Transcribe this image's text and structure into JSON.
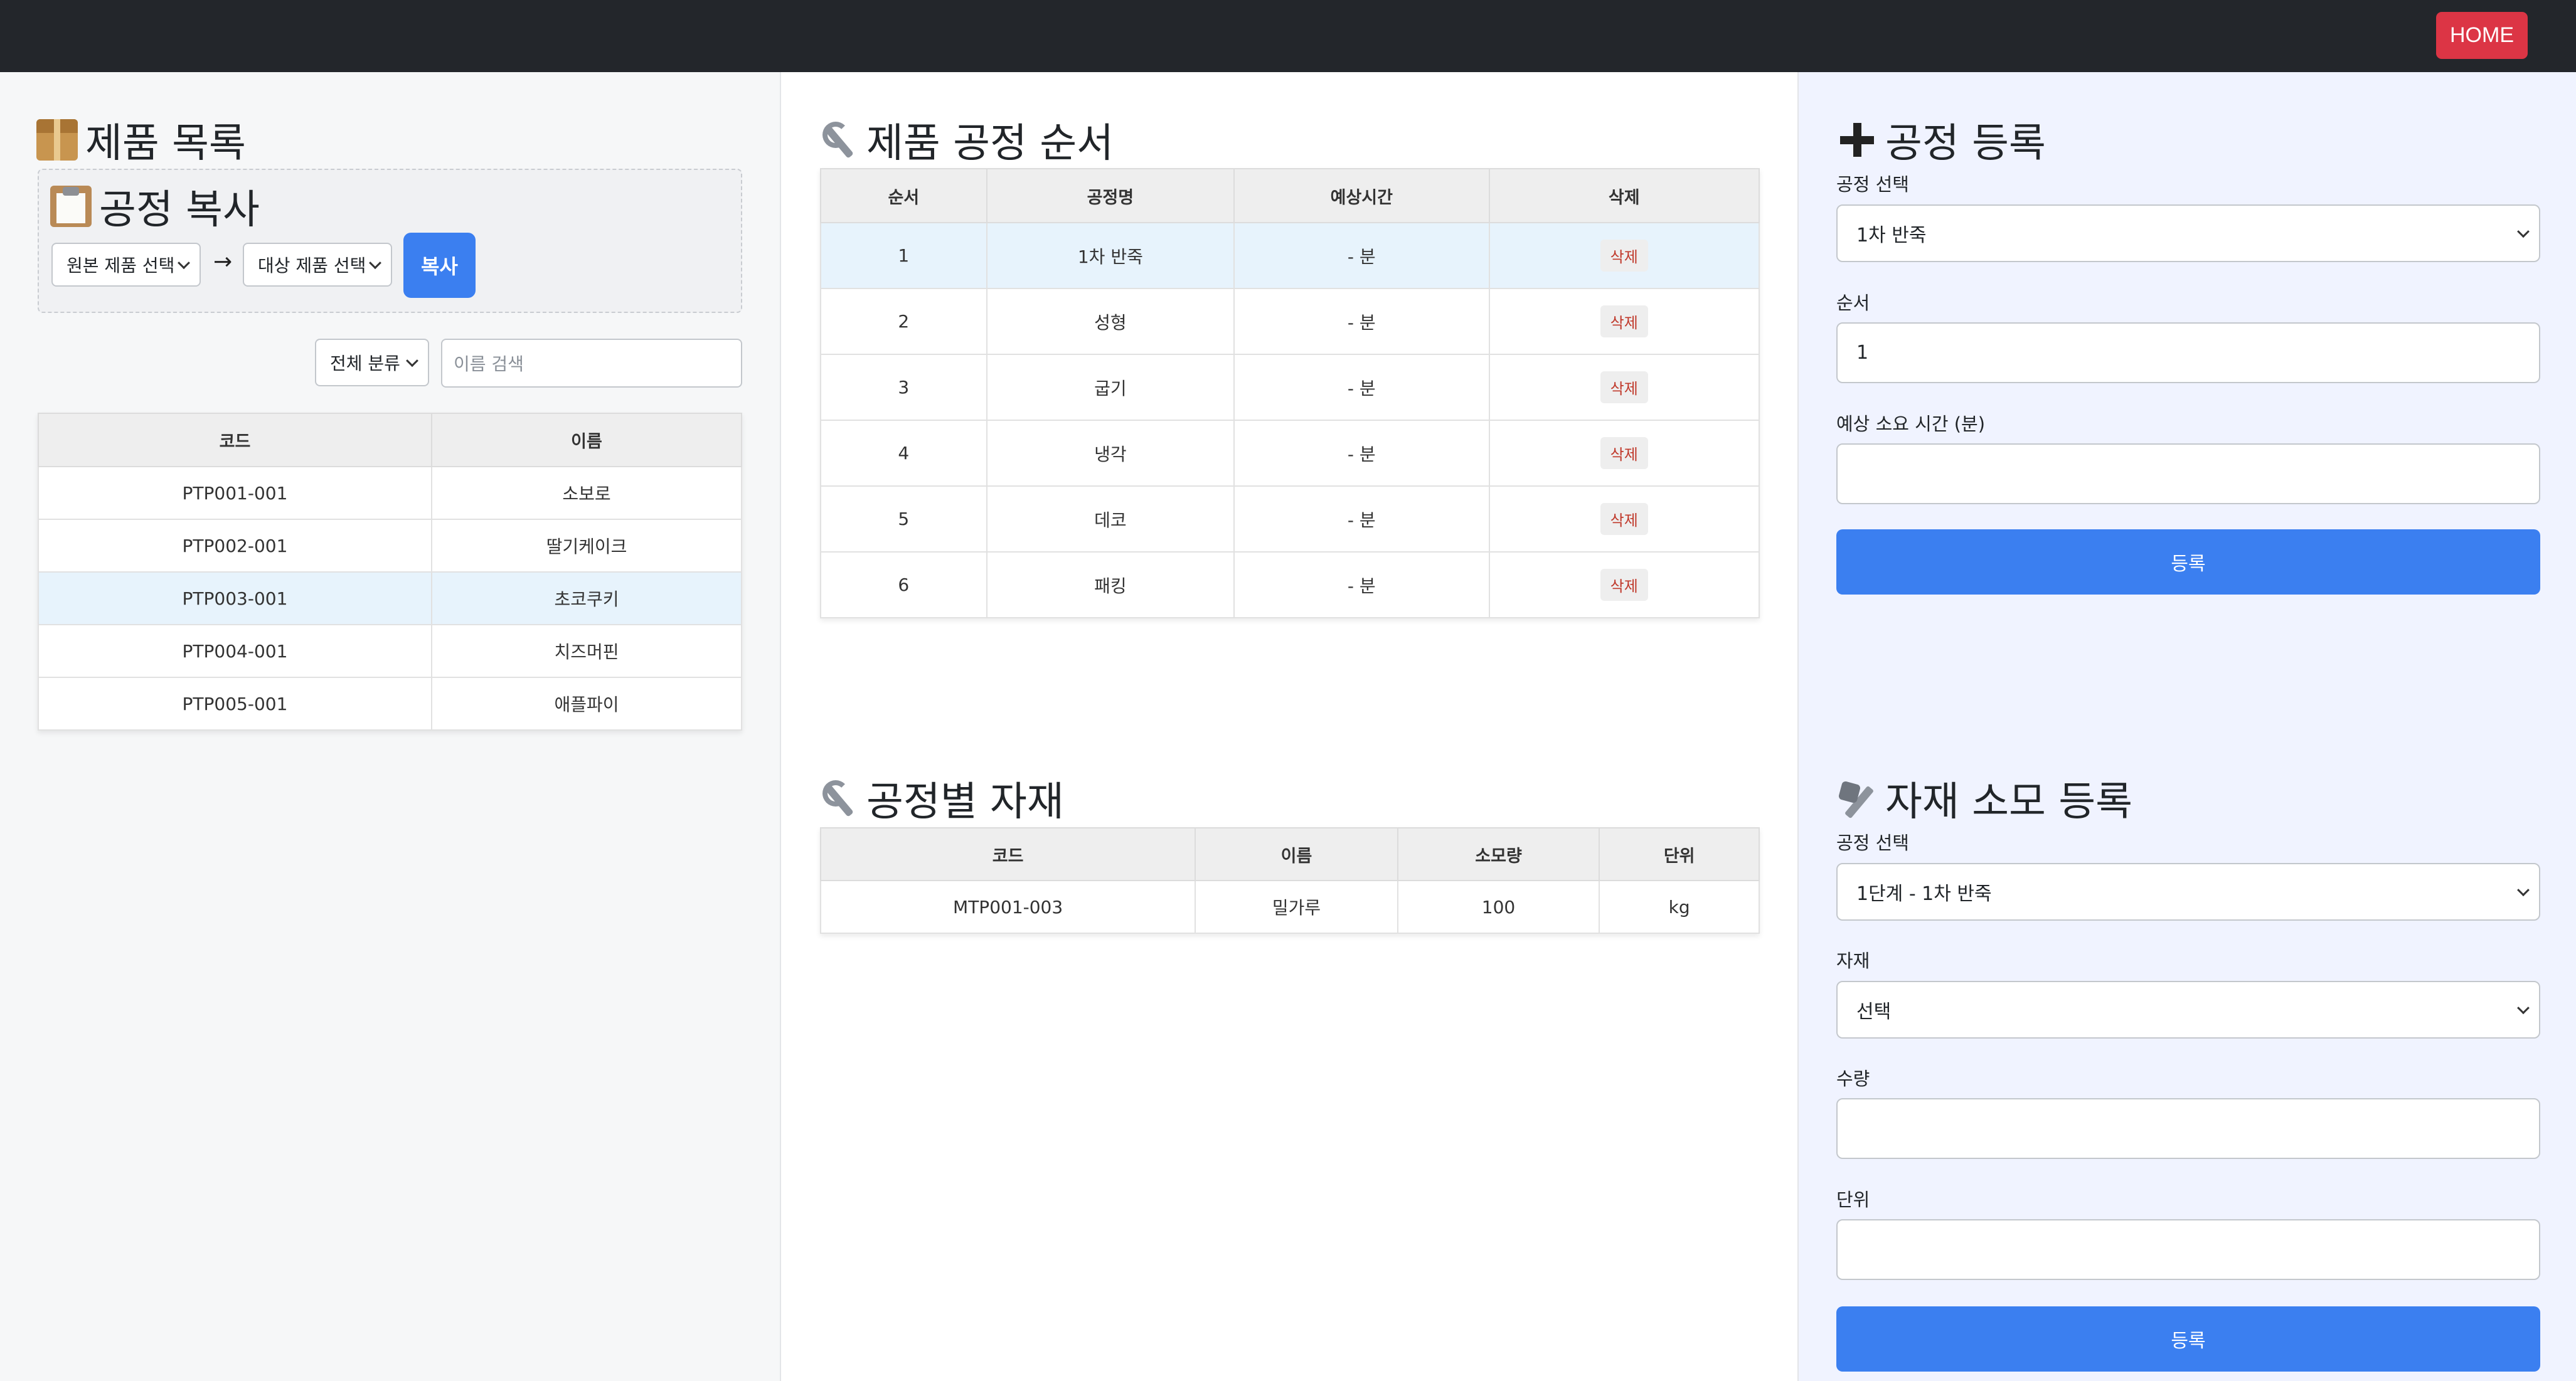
{
  "nav": {
    "home_label": "HOME"
  },
  "left": {
    "title": "제품 목록",
    "copy_title": "공정 복사",
    "source_select": "원본 제품 선택",
    "arrow": "→",
    "target_select": "대상 제품 선택",
    "copy_button": "복사",
    "category_select": "전체 분류",
    "search_placeholder": "이름 검색",
    "table": {
      "headers": [
        "코드",
        "이름"
      ],
      "rows": [
        [
          "PTP001-001",
          "소보로"
        ],
        [
          "PTP002-001",
          "딸기케이크"
        ],
        [
          "PTP003-001",
          "초코쿠키"
        ],
        [
          "PTP004-001",
          "치즈머핀"
        ],
        [
          "PTP005-001",
          "애플파이"
        ]
      ],
      "selected_row": 2
    }
  },
  "middle": {
    "process_title": "제품 공정 순서",
    "process_table": {
      "headers": [
        "순서",
        "공정명",
        "예상시간",
        "삭제"
      ],
      "rows": [
        [
          "1",
          "1차 반죽",
          "- 분",
          "삭제"
        ],
        [
          "2",
          "성형",
          "- 분",
          "삭제"
        ],
        [
          "3",
          "굽기",
          "- 분",
          "삭제"
        ],
        [
          "4",
          "냉각",
          "- 분",
          "삭제"
        ],
        [
          "5",
          "데코",
          "- 분",
          "삭제"
        ],
        [
          "6",
          "패킹",
          "- 분",
          "삭제"
        ]
      ],
      "selected_row": 0
    },
    "material_title": "공정별 자재",
    "material_table": {
      "headers": [
        "코드",
        "이름",
        "소모량",
        "단위"
      ],
      "rows": [
        [
          "MTP001-003",
          "밀가루",
          "100",
          "kg"
        ]
      ]
    }
  },
  "right": {
    "register_title": "공정 등록",
    "process_select_label": "공정 선택",
    "process_select_value": "1차 반죽",
    "order_label": "순서",
    "order_value": "1",
    "time_label": "예상 소요 시간 (분)",
    "time_value": "",
    "register_button": "등록",
    "material_title": "자재 소모 등록",
    "mat_process_label": "공정 선택",
    "mat_process_value": "1단계 - 1차 반죽",
    "material_label": "자재",
    "material_value": "선택",
    "quantity_label": "수량",
    "quantity_value": "",
    "unit_label": "단위",
    "unit_value": "",
    "material_button": "등록"
  },
  "colors": {
    "nav_bg": "#23262b",
    "home_button": "#dc3545",
    "primary": "#3b7ff0",
    "delete_text": "#c0392b",
    "selected_row": "#e7f3fc"
  },
  "icons": {
    "product_list": "package-icon",
    "copy": "clipboard-icon",
    "process": "wrench-icon",
    "register": "plus-icon",
    "material_usage": "nut-and-bolt-icon"
  }
}
